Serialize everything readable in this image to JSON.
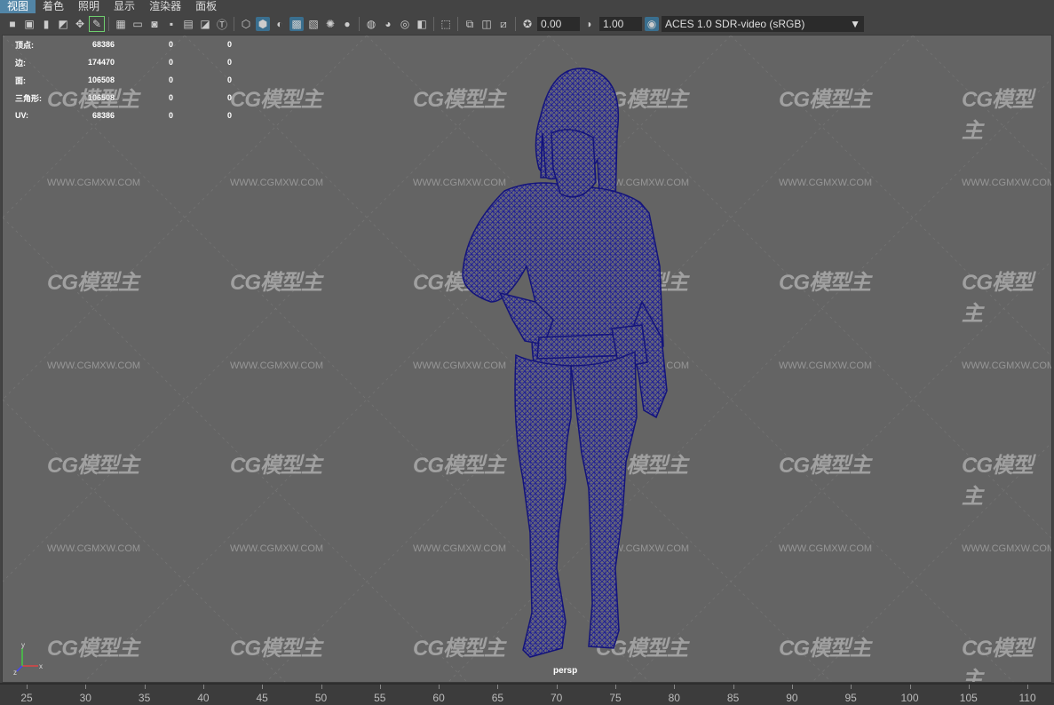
{
  "menubar": {
    "items": [
      "视图",
      "着色",
      "照明",
      "显示",
      "渲染器",
      "面板"
    ]
  },
  "toolbar": {
    "icons": [
      "camera-icon",
      "camera-attr-icon",
      "bookmark-icon",
      "image-plane-icon",
      "pin-icon",
      "2d-pan-icon",
      "grease-pencil-icon",
      "grid-icon",
      "film-gate-icon",
      "resolution-gate-icon",
      "gate-mask-icon",
      "field-chart-icon",
      "safe-action-icon",
      "safe-title-icon",
      "wireframe-icon",
      "smooth-shade-icon",
      "default-material-icon",
      "wireframe-on-shaded-icon",
      "xray-icon",
      "use-all-lights-icon",
      "shadows-icon",
      "screen-space-ao-icon",
      "motion-blur-icon",
      "multisample-icon",
      "depth-of-field-icon",
      "isolate-select-icon",
      "xray-joints-icon",
      "xray-active-icon",
      "backface-icon",
      "exposure-icon",
      "gamma-icon",
      "color-manage-icon"
    ],
    "exposure": "0.00",
    "gamma": "1.00",
    "view_transform": "ACES 1.0 SDR-video (sRGB)"
  },
  "hud": {
    "rows": [
      {
        "label": "顶点:",
        "v1": "68386",
        "v2": "0",
        "v3": "0"
      },
      {
        "label": "边:",
        "v1": "174470",
        "v2": "0",
        "v3": "0"
      },
      {
        "label": "面:",
        "v1": "106508",
        "v2": "0",
        "v3": "0"
      },
      {
        "label": "三角形:",
        "v1": "106508",
        "v2": "0",
        "v3": "0"
      },
      {
        "label": "UV:",
        "v1": "68386",
        "v2": "0",
        "v3": "0"
      }
    ]
  },
  "watermark": {
    "logo": "CG模型主",
    "url": "WWW.CGMXW.COM"
  },
  "viewport": {
    "camera_label": "persp",
    "mesh_color": "#1a1a8c"
  },
  "axis": {
    "x": "x",
    "y": "y",
    "z": "z"
  },
  "timeline": {
    "ticks": [
      "25",
      "30",
      "35",
      "40",
      "45",
      "50",
      "55",
      "60",
      "65",
      "70",
      "75",
      "80",
      "85",
      "90",
      "95",
      "100",
      "105",
      "110"
    ]
  }
}
